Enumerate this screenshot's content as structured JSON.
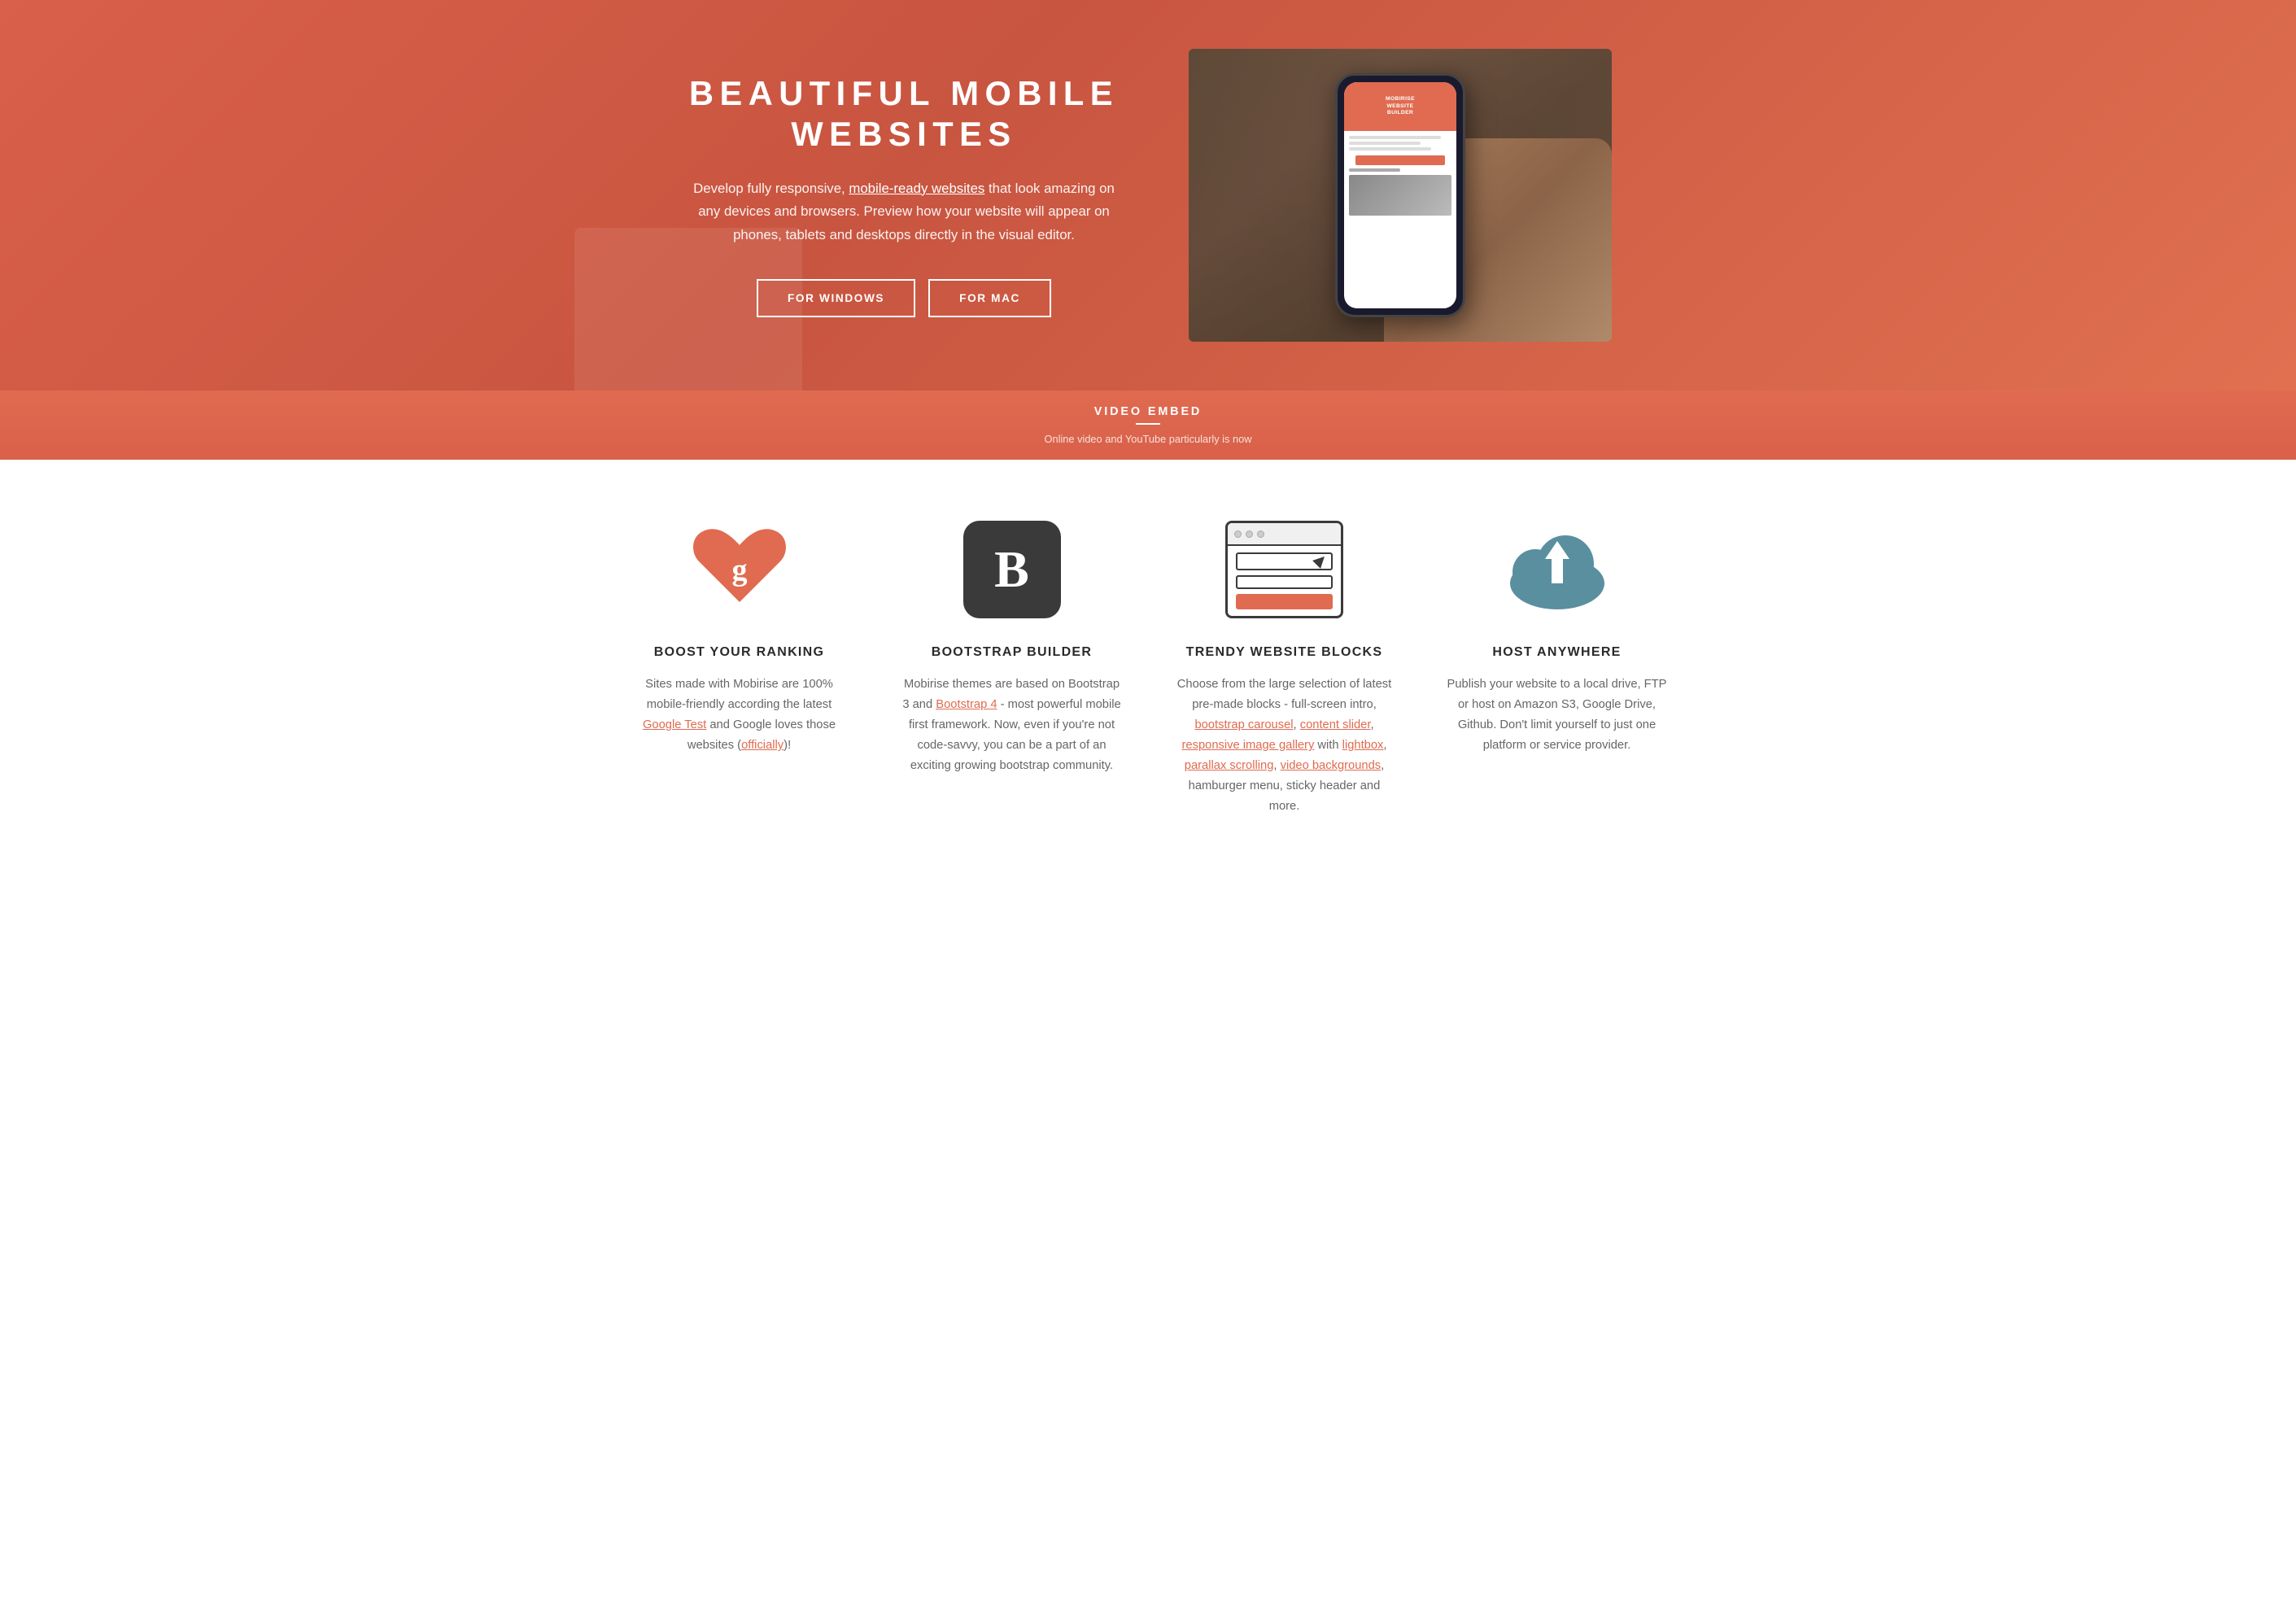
{
  "hero": {
    "title": "BEAUTIFUL MOBILE WEBSITES",
    "description_part1": "Develop fully responsive, ",
    "description_link": "mobile-ready websites",
    "description_part2": " that look amazing on any devices and browsers. Preview how your website will appear on phones, tablets and desktops directly in the visual editor.",
    "button_windows": "FOR WINDOWS",
    "button_mac": "FOR MAC",
    "phone_screen_title": "MOBIRISE WEBSITE BUILDER"
  },
  "video_embed": {
    "title": "VIDEO EMBED",
    "description": "Online video and YouTube particularly is now"
  },
  "features": [
    {
      "id": "boost-ranking",
      "title": "BOOST YOUR RANKING",
      "desc_plain": "Sites made with Mobirise are 100% mobile-friendly according the latest ",
      "link1_text": "Google Test",
      "desc_middle": " and Google loves those websites (",
      "link2_text": "officially",
      "desc_end": ")!"
    },
    {
      "id": "bootstrap-builder",
      "title": "BOOTSTRAP BUILDER",
      "desc_plain": "Mobirise themes are based on Bootstrap 3 and ",
      "link1_text": "Bootstrap 4",
      "desc_middle": " - most powerful mobile first framework. Now, even if you're not code-savvy, you can be a part of an exciting growing bootstrap community.",
      "link1_href": "#"
    },
    {
      "id": "trendy-blocks",
      "title": "TRENDY WEBSITE BLOCKS",
      "desc_plain": "Choose from the large selection of latest pre-made blocks - full-screen intro, ",
      "link1_text": "bootstrap carousel",
      "desc_sep1": ", ",
      "link2_text": "content slider",
      "desc_sep2": ", ",
      "link3_text": "responsive image gallery",
      "desc_part3": " with ",
      "link4_text": "lightbox",
      "desc_sep3": ", ",
      "link5_text": "parallax scrolling",
      "desc_sep4": ", ",
      "link6_text": "video backgrounds",
      "desc_end": ", hamburger menu, sticky header and more."
    },
    {
      "id": "host-anywhere",
      "title": "HOST ANYWHERE",
      "desc": "Publish your website to a local drive, FTP or host on Amazon S3, Google Drive, Github. Don't limit yourself to just one platform or service provider."
    }
  ]
}
